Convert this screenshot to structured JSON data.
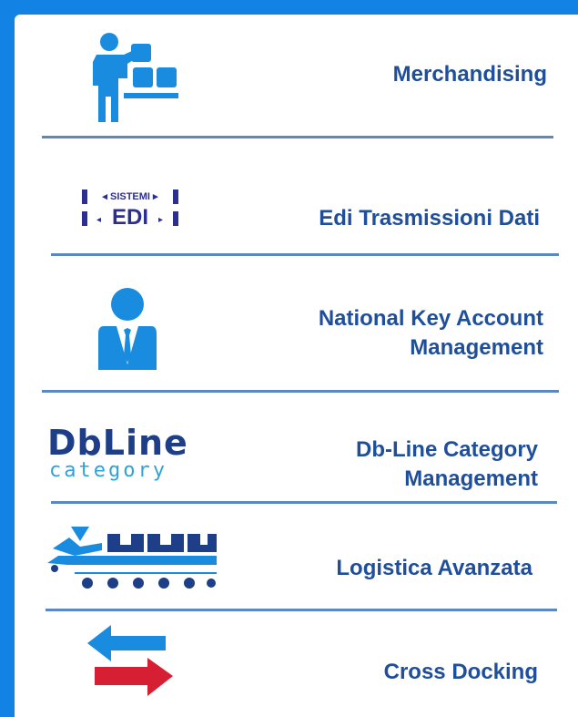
{
  "items": [
    {
      "label": "Merchandising",
      "icon": "merchandising-icon"
    },
    {
      "label": "Edi Trasmissioni Dati",
      "icon": "edi-icon",
      "icon_text": "SISTEMI EDI"
    },
    {
      "label_line1": "National Key Account",
      "label_line2": "Management",
      "icon": "key-account-person-icon"
    },
    {
      "label_line1": "Db-Line Category",
      "label_line2": "Management",
      "icon": "dbline-logo",
      "logo_main": "DbLine",
      "logo_sub": "category"
    },
    {
      "label": "Logistica Avanzata",
      "icon": "logistics-conveyor-icon"
    },
    {
      "label": "Cross Docking",
      "icon": "cross-docking-arrows-icon"
    }
  ],
  "colors": {
    "frame": "#1283e4",
    "label": "#1f4e9b",
    "divider": "#5b87c3",
    "icon_blue": "#1a8ce0",
    "arrow_red": "#d71f33"
  }
}
